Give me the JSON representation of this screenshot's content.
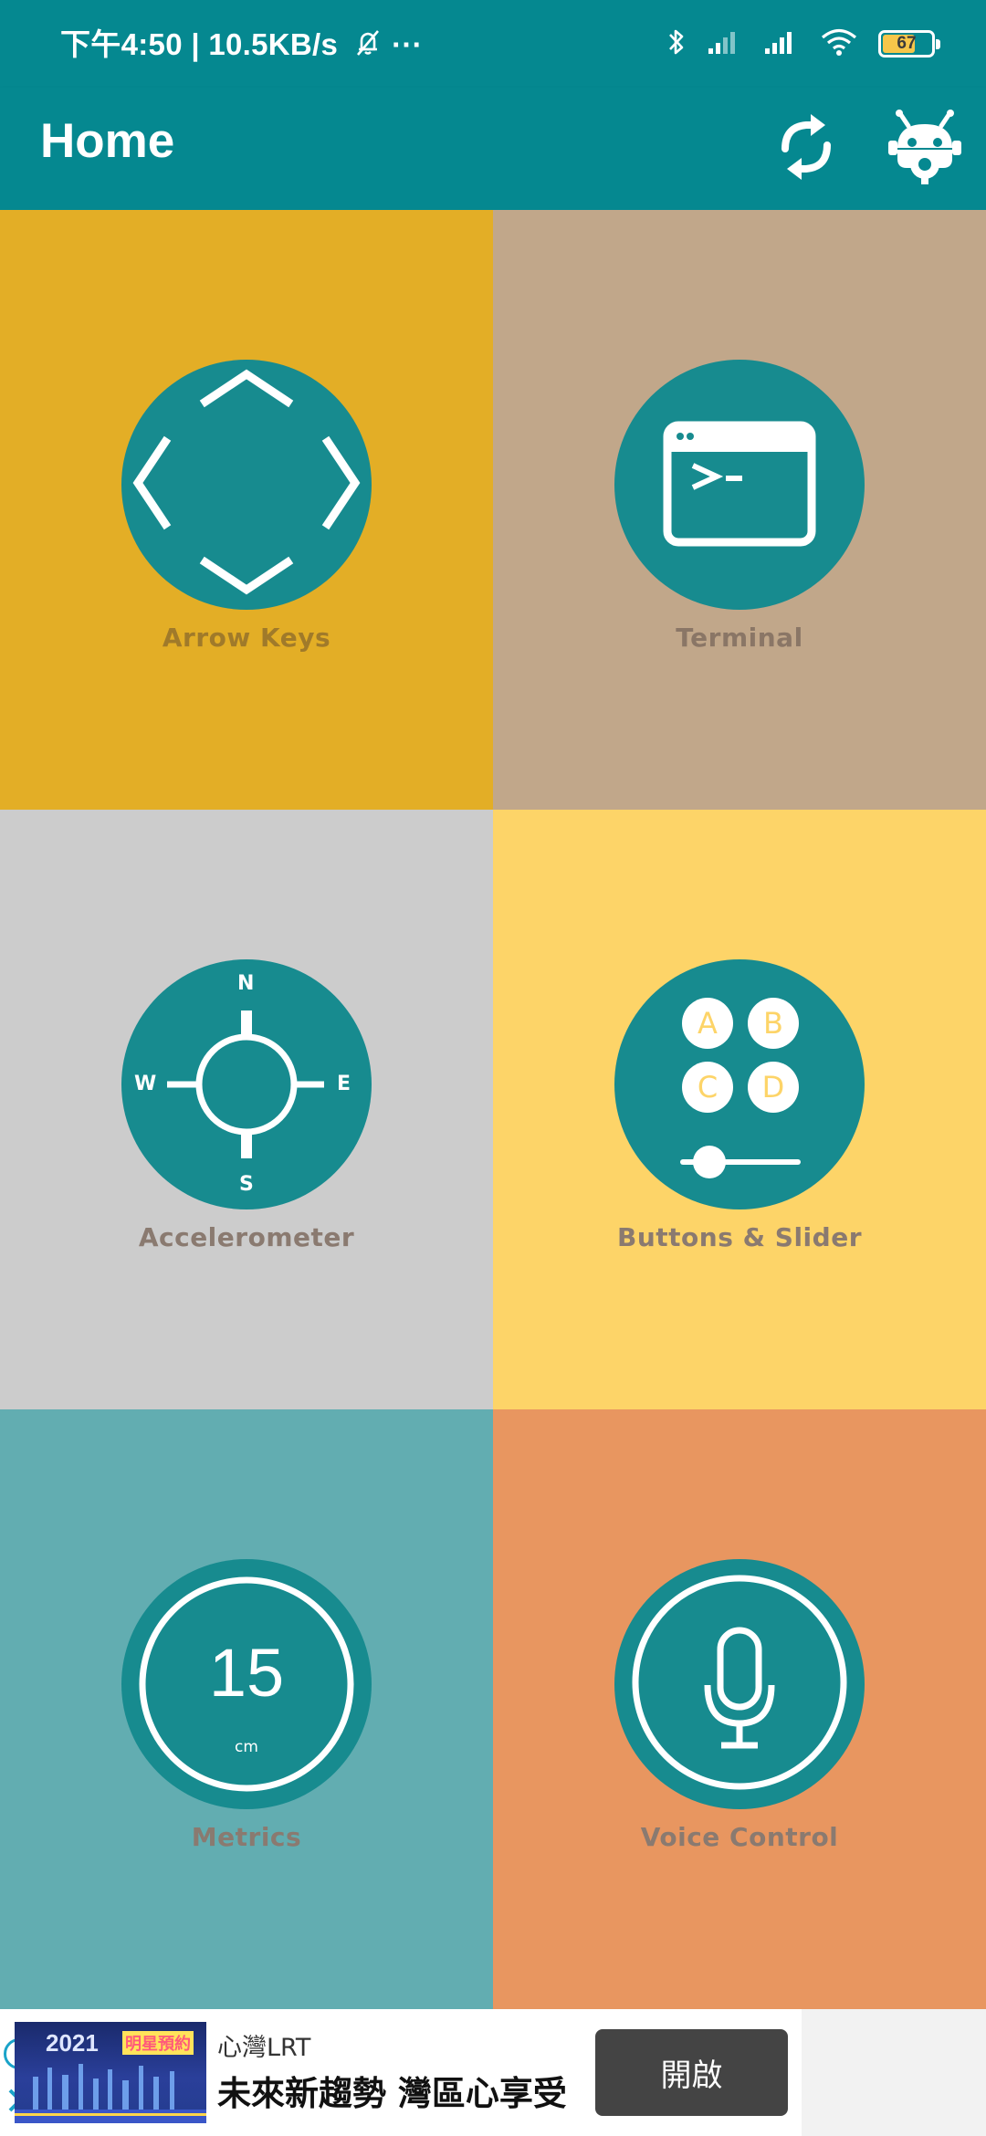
{
  "status_bar": {
    "time": "下午4:50",
    "network_speed": "10.5KB/s",
    "overflow": "···",
    "battery_level": "67",
    "battery_fraction": 0.67,
    "icons": [
      "bell-off-icon",
      "bluetooth-icon",
      "signal-icon",
      "signal-icon",
      "wifi-icon",
      "battery-icon"
    ]
  },
  "app_bar": {
    "title": "Home",
    "actions": [
      "sync-icon",
      "robot-settings-icon"
    ]
  },
  "tiles": [
    {
      "label": "Arrow Keys",
      "icon": "arrow-keys-icon",
      "bg": "#e3ae26",
      "label_color": "#a07a2a"
    },
    {
      "label": "Terminal",
      "icon": "terminal-icon",
      "bg": "#c1a78a",
      "label_color": "#8a7666"
    },
    {
      "label": "Accelerometer",
      "icon": "compass-icon",
      "bg": "#cccccc",
      "label_color": "#8a7a70",
      "compass": {
        "n": "N",
        "e": "E",
        "s": "S",
        "w": "W"
      }
    },
    {
      "label": "Buttons & Slider",
      "icon": "buttons-slider-icon",
      "bg": "#fdd468",
      "label_color": "#8a7a70",
      "buttons": [
        "A",
        "B",
        "C",
        "D"
      ]
    },
    {
      "label": "Metrics",
      "icon": "metrics-icon",
      "bg": "#62adb1",
      "label_color": "#8a7a70",
      "metric_value": "15",
      "metric_unit": "cm"
    },
    {
      "label": "Voice Control",
      "icon": "microphone-icon",
      "bg": "#e89660",
      "label_color": "#8a7a70"
    }
  ],
  "ad": {
    "image_year": "2021",
    "image_tag": "明星預約",
    "small_text": "心灣LRT",
    "big_text": "未來新趨勢 灣區心享受",
    "button_label": "開啟",
    "info_glyph": "i"
  },
  "colors": {
    "primary": "#058890",
    "circle": "#178b8f"
  }
}
